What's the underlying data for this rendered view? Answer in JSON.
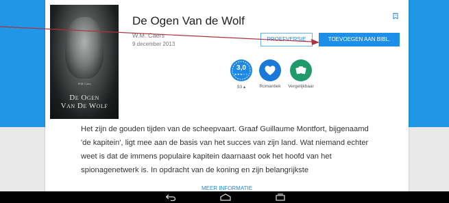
{
  "book": {
    "title": "De Ogen Van de Wolf",
    "author": "W.M. Caers",
    "date": "9 december 2013",
    "cover_author": "W.M. Caers",
    "cover_title_line1": "De Ogen",
    "cover_title_line2": "Van De Wolf"
  },
  "actions": {
    "preview_label": "PROEFVERSIE",
    "add_label": "TOEVOEGEN AAN BIBL."
  },
  "stats": {
    "rating_value": "3,0",
    "rating_stars": "★★★☆☆",
    "rating_count": "93 ▴",
    "genre_label": "Romantiek",
    "compare_label": "Vergelijkbaar"
  },
  "description": "Het zijn de gouden tijden van de scheepvaart. Graaf Guillaume Montfort, bijgenaamd 'de kapitein', ligt mee aan de basis van het succes van zijn land. Wat niemand echter weet is dat de immens populaire kapitein daarnaast ook het hoofd van het spionagenetwerk is. In opdracht van de koning en zijn belangrijkste",
  "more_label": "MEER INFORMATIE",
  "icons": {
    "bookmark": "bookmark-icon",
    "heart": "heart-icon",
    "compare": "cards-icon",
    "back": "back-icon",
    "home": "home-icon",
    "recents": "recents-icon"
  },
  "colors": {
    "header_blue": "#2196e6",
    "accent": "#1e88e5",
    "annotation": "#b0303a"
  }
}
